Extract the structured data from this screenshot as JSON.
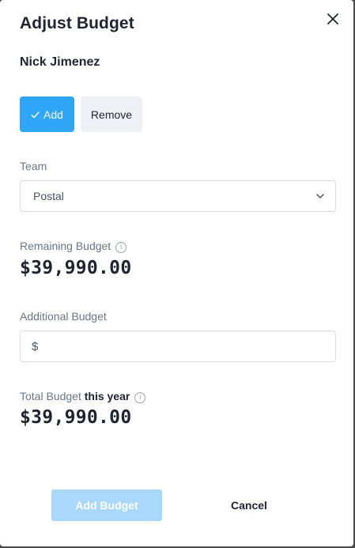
{
  "modal": {
    "title": "Adjust Budget",
    "user_name": "Nick Jimenez",
    "close_icon": "close-icon"
  },
  "mode_toggle": {
    "add_label": "Add",
    "remove_label": "Remove",
    "selected": "Add",
    "accent": "#2fa6f7"
  },
  "team": {
    "label": "Team",
    "selected": "Postal"
  },
  "remaining": {
    "label": "Remaining Budget",
    "amount": "$39,990.00"
  },
  "additional": {
    "label": "Additional Budget",
    "prefix": "$",
    "value": ""
  },
  "total": {
    "label": "Total Budget",
    "label_strong": "this year",
    "amount": "$39,990.00"
  },
  "footer": {
    "primary_label": "Add Budget",
    "cancel_label": "Cancel"
  }
}
